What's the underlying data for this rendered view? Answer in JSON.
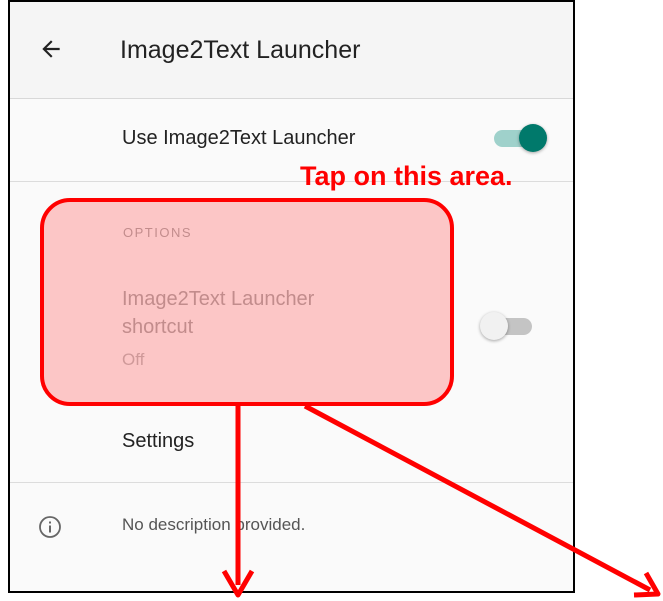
{
  "appbar": {
    "title": "Image2Text Launcher",
    "back_icon": "arrow-left-icon"
  },
  "main_switch": {
    "label": "Use Image2Text Launcher",
    "state": "on",
    "color": "#00796b"
  },
  "options": {
    "header": "OPTIONS",
    "shortcut": {
      "title_line1": "Image2Text Launcher",
      "title_line2": "shortcut",
      "status": "Off",
      "state": "off"
    }
  },
  "settings": {
    "label": "Settings"
  },
  "info": {
    "icon": "info-icon",
    "text": "No description provided."
  },
  "annotation": {
    "callout": "Tap on this area.",
    "color": "#ff0000"
  }
}
